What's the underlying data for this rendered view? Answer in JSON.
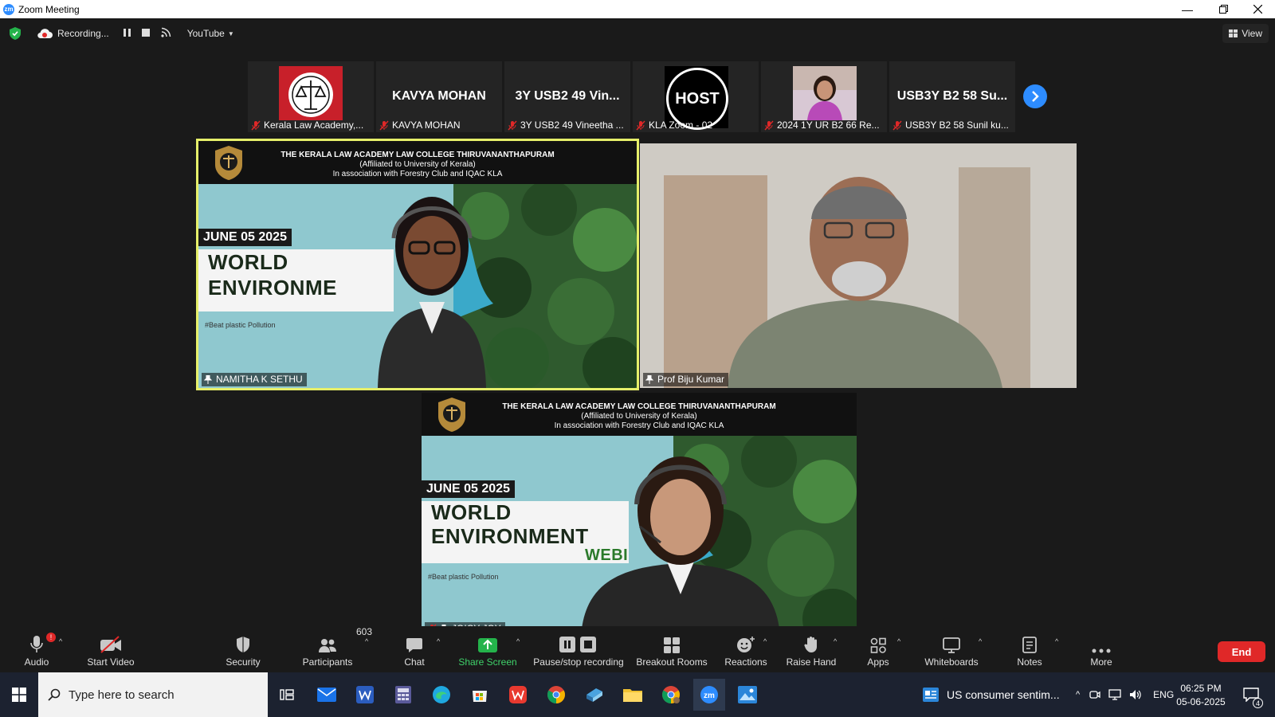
{
  "window": {
    "title": "Zoom Meeting",
    "logo_text": "zm"
  },
  "topbar": {
    "recording_label": "Recording...",
    "stream_label": "YouTube",
    "view_label": "View"
  },
  "thumbnails": [
    {
      "display": "",
      "name": "Kerala Law Academy,..."
    },
    {
      "display": "KAVYA MOHAN",
      "name": "KAVYA MOHAN"
    },
    {
      "display": "3Y USB2 49 Vin...",
      "name": "3Y USB2 49 Vineetha ..."
    },
    {
      "display": "HOST",
      "name": "KLA Zoom - 02"
    },
    {
      "display": "",
      "name": "2024 1Y UR B2 66 Re..."
    },
    {
      "display": "USB3Y B2 58 Su...",
      "name": "USB3Y B2 58 Sunil ku..."
    }
  ],
  "slide": {
    "header_line1": "THE KERALA LAW ACADEMY LAW COLLEGE THIRUVANANTHAPURAM",
    "header_line2": "(Affiliated to University of Kerala)",
    "header_line3": "In association with Forestry Club and IQAC KLA",
    "date": "JUNE 05 2025",
    "title1_a": "WORLD",
    "title1_b": "ENVIRONME",
    "title2_b": "ENVIRONMENT",
    "title2_c": "WEBI",
    "hashtag": "#Beat plastic Pollution"
  },
  "tiles": {
    "active_speaker": "NAMITHA K SETHU",
    "speaker_right": "Prof Biju Kumar",
    "speaker_bottom": "JOICY JOY"
  },
  "toolbar": {
    "audio": "Audio",
    "start_video": "Start Video",
    "security": "Security",
    "participants": "Participants",
    "participants_count": "603",
    "chat": "Chat",
    "share_screen": "Share Screen",
    "pause_recording": "Pause/stop recording",
    "breakout_rooms": "Breakout Rooms",
    "reactions": "Reactions",
    "raise_hand": "Raise Hand",
    "apps": "Apps",
    "whiteboards": "Whiteboards",
    "notes": "Notes",
    "more": "More",
    "end": "End",
    "audio_badge": "!"
  },
  "taskbar": {
    "search_placeholder": "Type here to search",
    "news": "US consumer sentim...",
    "lang": "ENG",
    "time": "06:25 PM",
    "date": "05-06-2025",
    "notification_count": "4"
  },
  "colors": {
    "accent": "#2d8cff",
    "active_border": "#e6ef6a",
    "end": "#e02828",
    "share_green": "#24b34b"
  }
}
